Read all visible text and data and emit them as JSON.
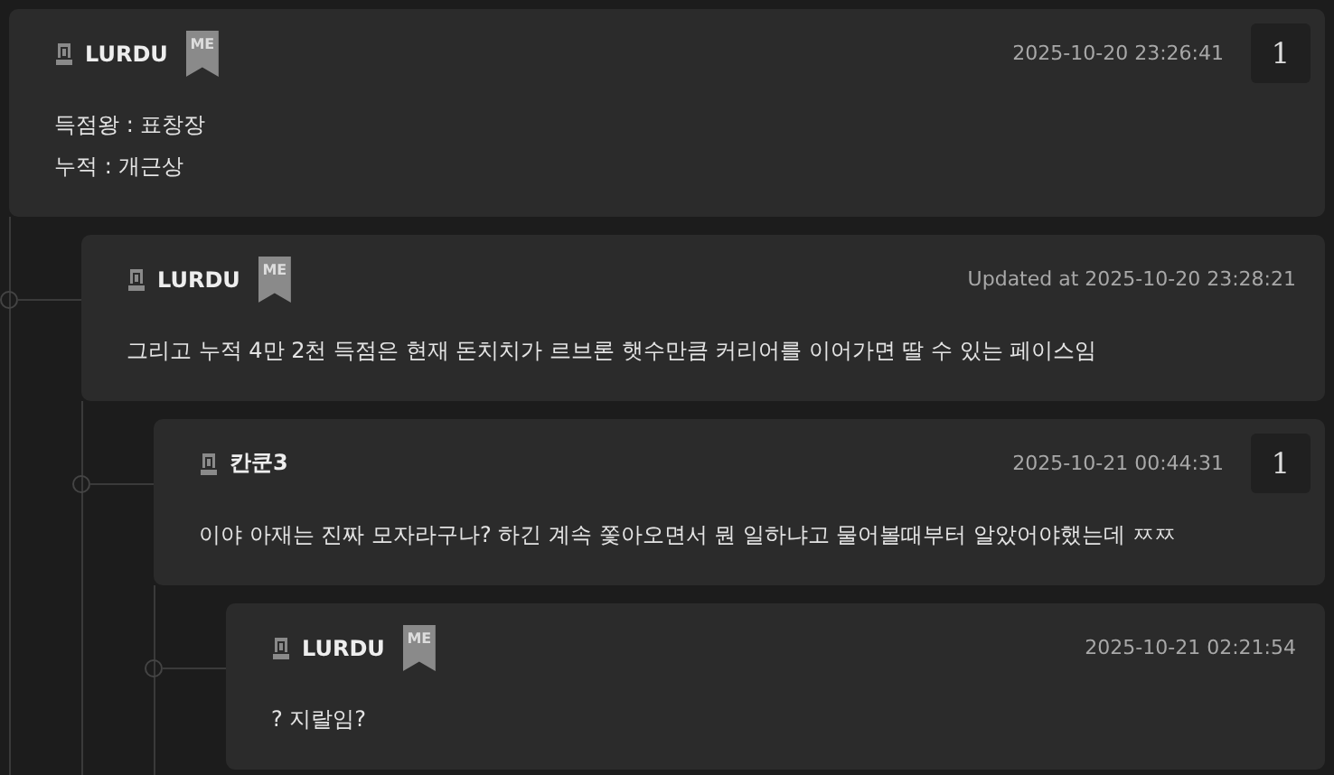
{
  "comments": [
    {
      "author": "LURDU",
      "badge": "ME",
      "time": "2025-10-20 23:26:41",
      "reply_count": "1",
      "body": [
        "득점왕 : 표창장",
        "누적 : 개근상"
      ],
      "children": [
        {
          "author": "LURDU",
          "badge": "ME",
          "time": "Updated at 2025-10-20 23:28:21",
          "body": [
            "그리고 누적 4만 2천 득점은 현재 돈치치가 르브론 햇수만큼 커리어를 이어가면 딸 수 있는 페이스임"
          ],
          "children": [
            {
              "author": "칸쿤3",
              "time": "2025-10-21 00:44:31",
              "reply_count": "1",
              "body": [
                "이야 아재는 진짜 모자라구나? 하긴 계속 쫓아오면서 뭔 일하냐고 물어볼때부터 알았어야했는데 ㅉㅉ"
              ],
              "children": [
                {
                  "author": "LURDU",
                  "badge": "ME",
                  "time": "2025-10-21 02:21:54",
                  "body": [
                    "? 지랄임?"
                  ]
                }
              ]
            }
          ]
        }
      ]
    }
  ]
}
